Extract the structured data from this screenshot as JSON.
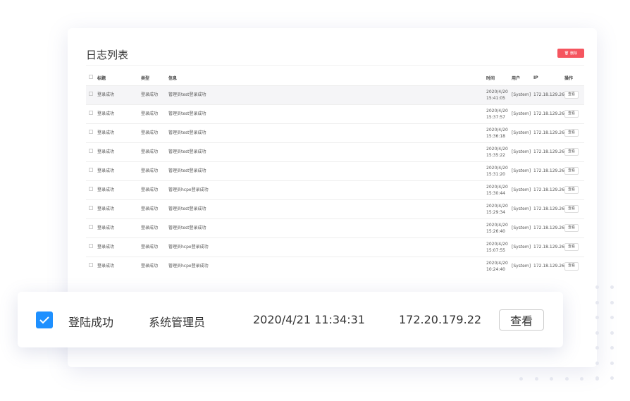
{
  "title": "日志列表",
  "delete_label": "删除",
  "columns": [
    "标题",
    "类型",
    "信息",
    "时间",
    "用户",
    "IP",
    "操作"
  ],
  "rows": [
    {
      "title": "登录成功",
      "type": "登录成功",
      "info": "管理员test登录成功",
      "date": "2020/4/20",
      "time": "15:41:05",
      "user": "[System]",
      "ip": "172.18.129.26",
      "action": "查看"
    },
    {
      "title": "登录成功",
      "type": "登录成功",
      "info": "管理员test登录成功",
      "date": "2020/4/20",
      "time": "15:37:57",
      "user": "[System]",
      "ip": "172.18.129.26",
      "action": "查看"
    },
    {
      "title": "登录成功",
      "type": "登录成功",
      "info": "管理员test登录成功",
      "date": "2020/4/20",
      "time": "15:36:18",
      "user": "[System]",
      "ip": "172.18.129.26",
      "action": "查看"
    },
    {
      "title": "登录成功",
      "type": "登录成功",
      "info": "管理员test登录成功",
      "date": "2020/4/20",
      "time": "15:35:22",
      "user": "[System]",
      "ip": "172.18.129.26",
      "action": "查看"
    },
    {
      "title": "登录成功",
      "type": "登录成功",
      "info": "管理员test登录成功",
      "date": "2020/4/20",
      "time": "15:31:20",
      "user": "[System]",
      "ip": "172.18.129.26",
      "action": "查看"
    },
    {
      "title": "登录成功",
      "type": "登录成功",
      "info": "管理员hcpe登录成功",
      "date": "2020/4/20",
      "time": "15:30:44",
      "user": "[System]",
      "ip": "172.18.129.26",
      "action": "查看"
    },
    {
      "title": "登录成功",
      "type": "登录成功",
      "info": "管理员test登录成功",
      "date": "2020/4/20",
      "time": "15:29:34",
      "user": "[System]",
      "ip": "172.18.129.26",
      "action": "查看"
    },
    {
      "title": "登录成功",
      "type": "登录成功",
      "info": "管理员test登录成功",
      "date": "2020/4/20",
      "time": "15:26:40",
      "user": "[System]",
      "ip": "172.18.129.26",
      "action": "查看"
    },
    {
      "title": "登录成功",
      "type": "登录成功",
      "info": "管理员hcpe登录成功",
      "date": "2020/4/20",
      "time": "15:07:55",
      "user": "[System]",
      "ip": "172.18.129.26",
      "action": "查看"
    },
    {
      "title": "登录成功",
      "type": "登录成功",
      "info": "管理员hcpe登录成功",
      "date": "2020/4/20",
      "time": "10:24:40",
      "user": "[System]",
      "ip": "172.18.129.26",
      "action": "查看"
    }
  ],
  "highlight": {
    "checked": true,
    "title": "登陆成功",
    "user": "系统管理员",
    "datetime": "2020/4/21 11:34:31",
    "ip": "172.20.179.22",
    "action": "查看"
  },
  "colors": {
    "danger": "#f5555f",
    "primary": "#1e90ff"
  }
}
